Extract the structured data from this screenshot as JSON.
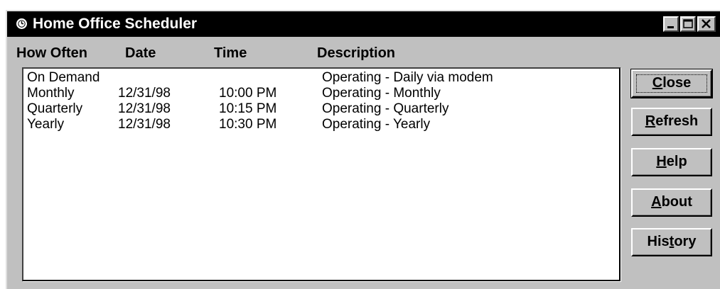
{
  "window": {
    "title": "Home Office Scheduler"
  },
  "title_icon": "clock-icon",
  "caption_buttons": {
    "minimize_icon": "minimize-icon",
    "maximize_icon": "maximize-icon",
    "close_icon": "close-icon"
  },
  "columns": {
    "how_often": "How Often",
    "date": "Date",
    "time": "Time",
    "description": "Description"
  },
  "rows": [
    {
      "how_often": "On Demand",
      "date": "",
      "time": "",
      "description": "Operating - Daily via modem"
    },
    {
      "how_often": "Monthly",
      "date": "12/31/98",
      "time": "10:00 PM",
      "description": "Operating - Monthly"
    },
    {
      "how_often": "Quarterly",
      "date": "12/31/98",
      "time": "10:15 PM",
      "description": "Operating - Quarterly"
    },
    {
      "how_often": "Yearly",
      "date": "12/31/98",
      "time": "10:30 PM",
      "description": "Operating - Yearly"
    }
  ],
  "buttons": {
    "close": {
      "pre": "",
      "key": "C",
      "post": "lose"
    },
    "refresh": {
      "pre": "",
      "key": "R",
      "post": "efresh"
    },
    "help": {
      "pre": "",
      "key": "H",
      "post": "elp"
    },
    "about": {
      "pre": "",
      "key": "A",
      "post": "bout"
    },
    "history": {
      "pre": "His",
      "key": "t",
      "post": "ory"
    }
  },
  "colors": {
    "titlebar": "#000000",
    "face": "#c0c0c0",
    "list_background": "#ffffff"
  }
}
